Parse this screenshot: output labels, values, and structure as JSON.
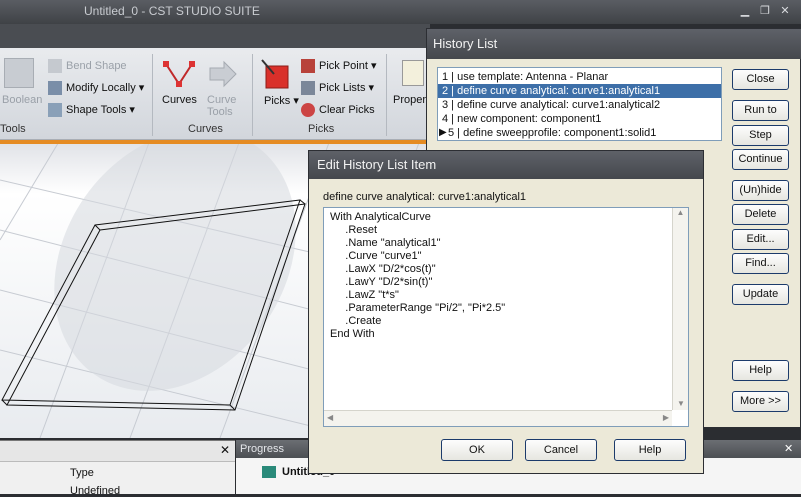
{
  "app": {
    "title": "Untitled_0 - CST STUDIO SUITE"
  },
  "ribbon": {
    "boolean_label": "Boolean",
    "bend_shape_label": "Bend Shape",
    "modify_locally_label": "Modify Locally",
    "shape_tools_label": "Shape Tools",
    "tools_group": "Tools",
    "curves_label": "Curves",
    "curve_tools_label": "Curve Tools",
    "curves_group": "Curves",
    "picks_label": "Picks",
    "pick_point_label": "Pick Point",
    "pick_lists_label": "Pick Lists",
    "clear_picks_label": "Clear Picks",
    "picks_group": "Picks",
    "properties_label": "Proper"
  },
  "history": {
    "title": "History List",
    "items": [
      {
        "label": "1 | use template: Antenna - Planar"
      },
      {
        "label": "2 | define curve analytical: curve1:analytical1"
      },
      {
        "label": "3 | define curve analytical: curve1:analytical2"
      },
      {
        "label": "4 | new component: component1"
      },
      {
        "label": "5 | define sweepprofile: component1:solid1"
      }
    ],
    "buttons": {
      "close": "Close",
      "run_to": "Run to",
      "step": "Step",
      "continue": "Continue",
      "unhide": "(Un)hide",
      "delete": "Delete",
      "edit": "Edit...",
      "find": "Find...",
      "update": "Update",
      "help": "Help",
      "more": "More >>"
    }
  },
  "edit": {
    "title": "Edit History List Item",
    "caption": "define curve analytical: curve1:analytical1",
    "lines": [
      "With AnalyticalCurve",
      "     .Reset",
      "     .Name \"analytical1\"",
      "     .Curve \"curve1\"",
      "     .LawX \"D/2*cos(t)\"",
      "     .LawY \"D/2*sin(t)\"",
      "     .LawZ \"t*s\"",
      "     .ParameterRange \"Pi/2\", \"Pi*2.5\"",
      "     .Create",
      "End With"
    ],
    "ok": "OK",
    "cancel": "Cancel",
    "help": "Help"
  },
  "panels": {
    "type_header": "Type",
    "type_value": "Undefined",
    "progress_title": "Progress",
    "progress_item": "Untitled_0"
  },
  "colors": {
    "selection": "#3d6fa8",
    "accent_orange": "#e58b23",
    "pick_red": "#d9302a"
  }
}
